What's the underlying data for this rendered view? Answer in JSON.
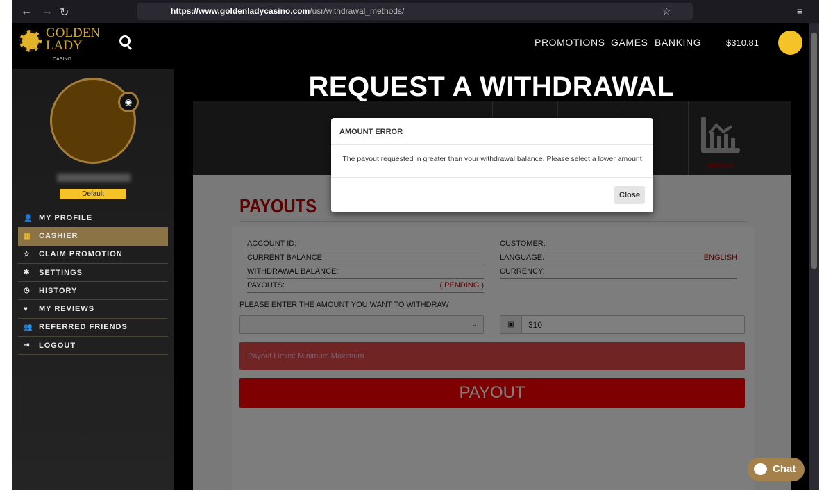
{
  "browser": {
    "url_domain": "https://www.goldenladycasino.com",
    "url_path": "/usr/withdrawal_methods/"
  },
  "header": {
    "logo_line1": "GOLDEN",
    "logo_line2": "LADY",
    "logo_line3": "CASINO",
    "nav": [
      "PROMOTIONS",
      "GAMES",
      "BANKING"
    ],
    "balance": "$310.81"
  },
  "sidebar": {
    "badge": "Default",
    "items": [
      {
        "label": "MY PROFILE",
        "icon": "user-icon",
        "active": false
      },
      {
        "label": "CASHIER",
        "icon": "bank-icon",
        "active": true
      },
      {
        "label": "CLAIM PROMOTION",
        "icon": "star-icon",
        "active": false
      },
      {
        "label": "SETTINGS",
        "icon": "gear-icon",
        "active": false
      },
      {
        "label": "HISTORY",
        "icon": "clock-icon",
        "active": false
      },
      {
        "label": "MY REVIEWS",
        "icon": "heart-icon",
        "active": false
      },
      {
        "label": "REFERRED FRIENDS",
        "icon": "user-plus-icon",
        "active": false
      },
      {
        "label": "LOGOUT",
        "icon": "logout-icon",
        "active": false
      }
    ]
  },
  "main": {
    "title": "REQUEST A WITHDRAWAL",
    "tab_history": "HISTORY",
    "section": "PAYOUTS",
    "left_fields": [
      {
        "label": "ACCOUNT ID:",
        "value": ""
      },
      {
        "label": "CURRENT BALANCE:",
        "value": ""
      },
      {
        "label": "WITHDRAWAL BALANCE:",
        "value": ""
      },
      {
        "label": "PAYOUTS:",
        "value": "( PENDING )"
      }
    ],
    "right_fields": [
      {
        "label": "CUSTOMER:",
        "value": ""
      },
      {
        "label": "LANGUAGE:",
        "value": "ENGLISH"
      },
      {
        "label": "CURRENCY:",
        "value": ""
      }
    ],
    "prompt": "PLEASE ENTER THE AMOUNT YOU WANT TO WITHDRAW",
    "amount": "310",
    "limits": "Payout Limits: Minimum Maximum",
    "payout_button": "PAYOUT"
  },
  "modal": {
    "title": "AMOUNT ERROR",
    "message": "The payout requested in greater than your withdrawal balance. Please select a lower amount",
    "close": "Close"
  },
  "chat": {
    "label": "Chat"
  }
}
